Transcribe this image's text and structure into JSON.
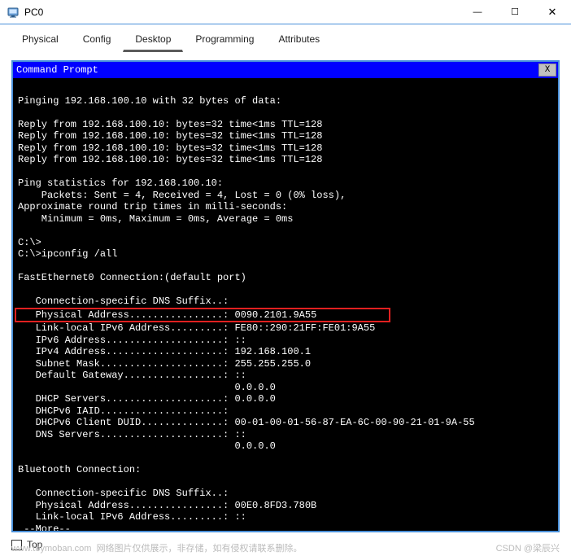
{
  "window": {
    "title": "PC0",
    "minimize": "—",
    "maximize": "☐",
    "close": "✕"
  },
  "tabs": {
    "physical": "Physical",
    "config": "Config",
    "desktop": "Desktop",
    "programming": "Programming",
    "attributes": "Attributes"
  },
  "terminal": {
    "title": "Command Prompt",
    "close": "X",
    "lines": {
      "l0": "",
      "l1": "Pinging 192.168.100.10 with 32 bytes of data:",
      "l2": "",
      "l3": "Reply from 192.168.100.10: bytes=32 time<1ms TTL=128",
      "l4": "Reply from 192.168.100.10: bytes=32 time<1ms TTL=128",
      "l5": "Reply from 192.168.100.10: bytes=32 time<1ms TTL=128",
      "l6": "Reply from 192.168.100.10: bytes=32 time<1ms TTL=128",
      "l7": "",
      "l8": "Ping statistics for 192.168.100.10:",
      "l9": "    Packets: Sent = 4, Received = 4, Lost = 0 (0% loss),",
      "l10": "Approximate round trip times in milli-seconds:",
      "l11": "    Minimum = 0ms, Maximum = 0ms, Average = 0ms",
      "l12": "",
      "l13": "C:\\>",
      "l14": "C:\\>ipconfig /all",
      "l15": "",
      "l16": "FastEthernet0 Connection:(default port)",
      "l17": "",
      "l18": "   Connection-specific DNS Suffix..:",
      "hlabel": "   Physical Address................: ",
      "hvalue": "0090.2101.9A55",
      "l20": "   Link-local IPv6 Address.........: FE80::290:21FF:FE01:9A55",
      "l21": "   IPv6 Address....................: ::",
      "l22": "   IPv4 Address....................: 192.168.100.1",
      "l23": "   Subnet Mask.....................: 255.255.255.0",
      "l24": "   Default Gateway.................: ::",
      "l25": "                                     0.0.0.0",
      "l26": "   DHCP Servers....................: 0.0.0.0",
      "l27": "   DHCPv6 IAID.....................:",
      "l28": "   DHCPv6 Client DUID..............: 00-01-00-01-56-87-EA-6C-00-90-21-01-9A-55",
      "l29": "   DNS Servers.....................: ::",
      "l30": "                                     0.0.0.0",
      "l31": "",
      "l32": "Bluetooth Connection:",
      "l33": "",
      "l34": "   Connection-specific DNS Suffix..:",
      "l35": "   Physical Address................: 00E0.8FD3.780B",
      "l36": "   Link-local IPv6 Address.........: ::",
      "l37": " --More--"
    }
  },
  "bottom": {
    "top_label": "Top"
  },
  "footer": {
    "url": "www.toymoban.com",
    "note": "网络图片仅供展示，非存储，如有侵权请联系删除。",
    "credit": "CSDN @梁辰兴"
  }
}
